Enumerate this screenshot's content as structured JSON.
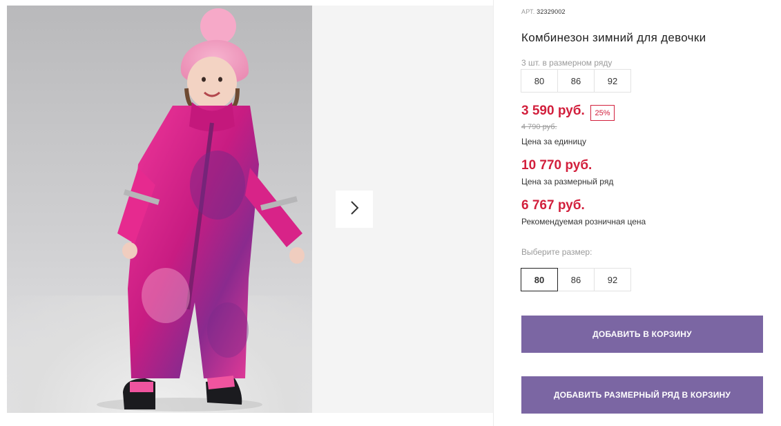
{
  "product": {
    "article_label": "АРТ.",
    "article_number": "32329002",
    "title": "Комбинезон зимний для девочки",
    "set_note": "3 шт. в размерном ряду",
    "set_sizes": [
      "80",
      "86",
      "92"
    ]
  },
  "pricing": {
    "unit_price": "3 590 руб.",
    "discount_badge": "25%",
    "old_price": "4 790 руб.",
    "unit_caption": "Цена за единицу",
    "set_price": "10 770 руб.",
    "set_caption": "Цена за размерный ряд",
    "rrp_price": "6 767 руб.",
    "rrp_caption": "Рекомендуемая розничная цена"
  },
  "size_picker": {
    "label": "Выберите размер:",
    "options": [
      "80",
      "86",
      "92"
    ],
    "selected": "80"
  },
  "actions": {
    "add_to_cart": "ДОБАВИТЬ В КОРЗИНУ",
    "add_set_to_cart": "ДОБАВИТЬ РАЗМЕРНЫЙ РЯД В КОРЗИНУ"
  },
  "gallery": {
    "next_icon": "chevron-right-icon"
  },
  "colors": {
    "price_red": "#d21f3c",
    "button_purple": "#7b66a3",
    "suit_pink": "#e8288a"
  }
}
